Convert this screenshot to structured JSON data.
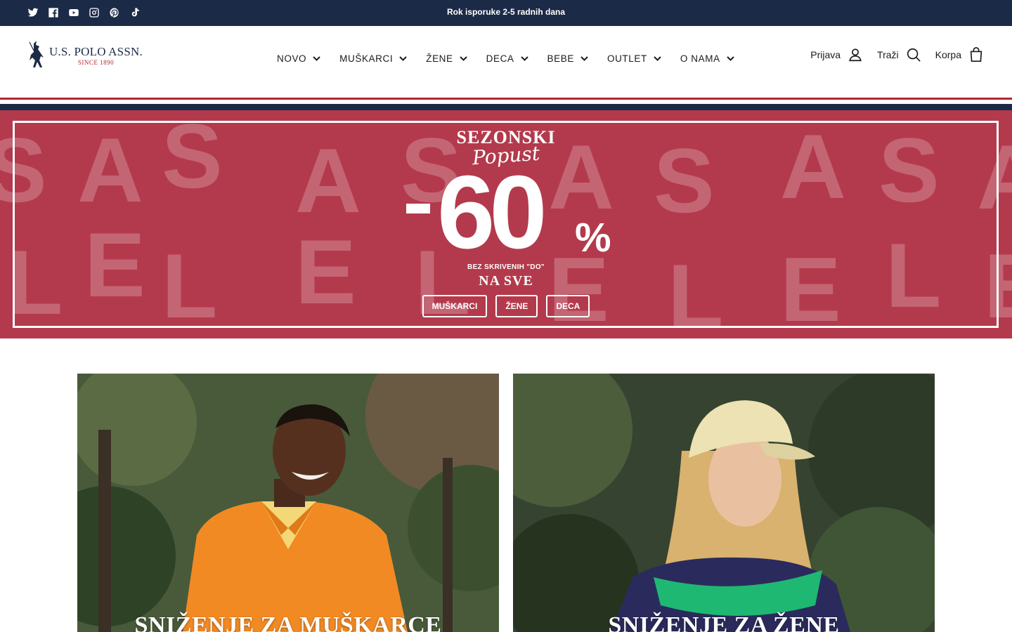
{
  "topbar": {
    "announcement": "Rok isporuke 2-5 radnih dana",
    "social_icons": [
      "twitter-icon",
      "facebook-icon",
      "youtube-icon",
      "instagram-icon",
      "pinterest-icon",
      "tiktok-icon"
    ],
    "background": "#1b2a47"
  },
  "header": {
    "logo_title": "U.S. POLO ASSN.",
    "logo_subtitle": "SINCE 1890",
    "nav": [
      {
        "label": "NOVO"
      },
      {
        "label": "MUŠKARCI"
      },
      {
        "label": "ŽENE"
      },
      {
        "label": "DECA"
      },
      {
        "label": "BEBE"
      },
      {
        "label": "OUTLET"
      },
      {
        "label": "O NAMA"
      }
    ],
    "login_label": "Prijava",
    "search_label": "Traži",
    "cart_label": "Korpa"
  },
  "banner": {
    "title": "SEZONSKI",
    "script": "Popust",
    "discount": "60",
    "percent": "%",
    "note": "BEZ SKRIVENIH \"DO\"",
    "subtitle": "NA SVE",
    "buttons": [
      "MUŠKARCI",
      "ŽENE",
      "DECA"
    ],
    "background": "#b33a4c"
  },
  "cards": [
    {
      "title": "SNIŽENJE ZA MUŠKARCE"
    },
    {
      "title": "SNIŽENJE ZA ŽENE"
    }
  ],
  "colors": {
    "navy": "#1b2a47",
    "red": "#b3262e"
  }
}
